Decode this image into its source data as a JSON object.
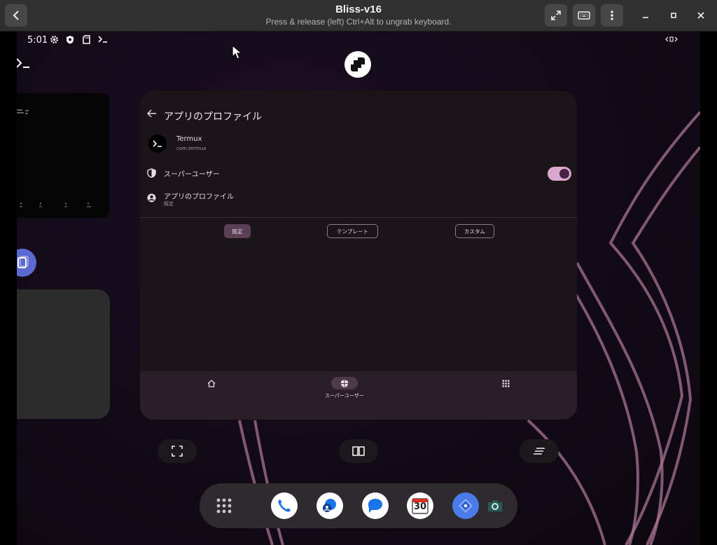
{
  "window": {
    "title": "Bliss-v16",
    "subtitle": "Press & release (left) Ctrl+Alt to ungrab keyboard.",
    "buttons": [
      "back-icon",
      "fullscreen-icon",
      "keyboard-icon",
      "menu-dots-icon",
      "minimize-icon",
      "maximize-icon",
      "close-icon"
    ]
  },
  "statusbar": {
    "time": "5:01",
    "icons": [
      "settings-gear-icon",
      "shield-icon",
      "sd-card-icon",
      "terminal-icon"
    ],
    "right_icon": "rotate-icon"
  },
  "left_peek": {
    "terminal_prompt": ">_",
    "card_text": "≡ ≡"
  },
  "profile_page": {
    "title": "アプリのプロファイル",
    "app": {
      "name": "Termux",
      "package": "com.termux",
      "icon_text": ">_"
    },
    "superuser": {
      "label": "スーパーユーザー",
      "enabled": true
    },
    "profile": {
      "label": "アプリのプロファイル",
      "value": "既定"
    },
    "segments": [
      {
        "label": "既定",
        "selected": true
      },
      {
        "label": "テンプレート",
        "selected": false
      },
      {
        "label": "カスタム",
        "selected": false
      }
    ],
    "bottom_nav": {
      "home_icon": "home-icon",
      "superuser_label": "スーパーユーザー",
      "apps_icon": "apps-grid-icon"
    }
  },
  "recents_actions": [
    "screenshot-select-icon",
    "split-screen-icon",
    "clear-all-icon"
  ],
  "dock": {
    "apps": [
      "app-drawer-icon",
      "phone-icon",
      "contacts-icon",
      "messages-icon",
      "calendar-icon",
      "maps-icon",
      "camera-icon"
    ],
    "calendar_day": "30"
  },
  "colors": {
    "host_header": "#303030",
    "card_bg": "#1b1419",
    "switch_on": "#d8a8d0",
    "nav_bg": "#2a1e28",
    "wallpaper_line": "#b07a9a"
  }
}
